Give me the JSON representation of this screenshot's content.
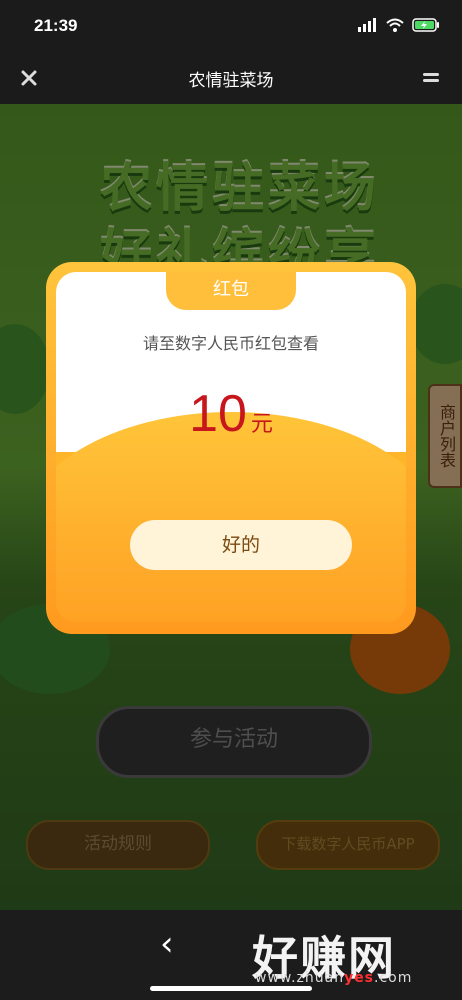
{
  "status": {
    "time": "21:39"
  },
  "nav": {
    "title": "农情驻菜场"
  },
  "hero": {
    "line1": "农情驻菜场",
    "line2": "好礼缤纷享"
  },
  "side_tag": "商户列表",
  "buttons": {
    "join": "参与活动",
    "rules": "活动规则",
    "download": "下载数字人民币APP"
  },
  "dialog": {
    "tab": "红包",
    "subtitle": "请至数字人民币红包查看",
    "amount": "10",
    "unit": "元",
    "ok": "好的"
  },
  "watermark": {
    "text": "好赚网",
    "url_prefix": "www.zhuan",
    "url_highlight": "yes",
    "url_suffix": ".com"
  },
  "colors": {
    "accent_orange": "#ffb52a",
    "amount_red": "#c8161d",
    "nav_bg": "#1b1b1b"
  },
  "icons": [
    "signal-icon",
    "wifi-icon",
    "battery-charging-icon",
    "close-icon",
    "menu-icon",
    "back-arrow-icon"
  ]
}
